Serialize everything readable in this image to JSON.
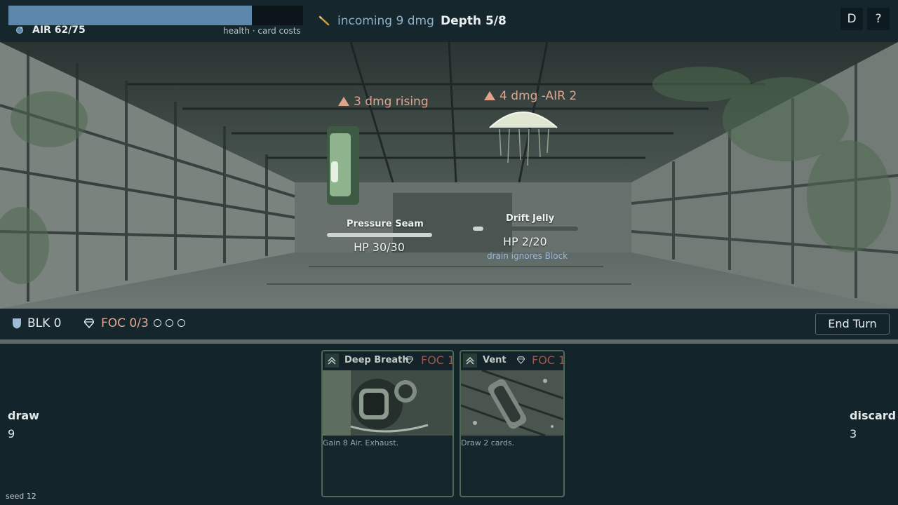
{
  "hud": {
    "air_label": "AIR 62/75",
    "air_current": 62,
    "air_max": 75,
    "air_subtitle": "health · card costs",
    "incoming": "incoming 9 dmg",
    "depth": "Depth 5/8",
    "btn_d": "D",
    "btn_help": "?"
  },
  "enemies": [
    {
      "intent": "3 dmg rising",
      "name": "Pressure Seam",
      "hp_label": "HP 30/30",
      "hp": 30,
      "hp_max": 30,
      "note": ""
    },
    {
      "intent": "4 dmg -AIR 2",
      "name": "Drift Jelly",
      "hp_label": "HP 2/20",
      "hp": 2,
      "hp_max": 20,
      "note": "drain ignores Block"
    }
  ],
  "status": {
    "block": "BLK 0",
    "focus": "FOC 0/3",
    "focus_current": 0,
    "focus_max": 3,
    "end_turn": "End Turn"
  },
  "piles": {
    "draw_label": "draw",
    "draw_count": "9",
    "discard_label": "discard",
    "discard_count": "3"
  },
  "hand": [
    {
      "title": "Deep Breath",
      "cost": "FOC 1",
      "text": "Gain 8 Air. Exhaust.",
      "art": "diving-helmet"
    },
    {
      "title": "Vent",
      "cost": "FOC 1",
      "text": "Draw 2 cards.",
      "art": "vent-pipe"
    }
  ],
  "footer": {
    "seed": "seed 12"
  },
  "colors": {
    "air_fill": "#5e88ab",
    "intent": "#e0a48e",
    "focus": "#e3a892",
    "card_border": "#4d6a55",
    "panel": "#15262d"
  }
}
